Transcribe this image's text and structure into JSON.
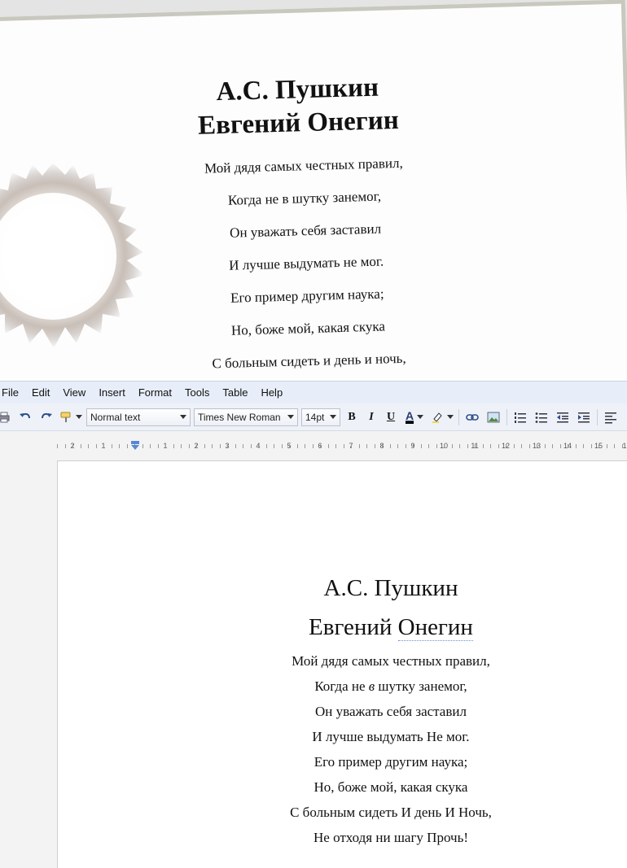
{
  "photo": {
    "title_lines": [
      "А.С. Пушкин",
      "Евгений Онегин"
    ],
    "lines": [
      "Мой дядя самых честных правил,",
      "Когда не в шутку занемог,",
      "Он уважать себя заставил",
      "И лучше выдумать не мог.",
      "Его пример другим наука;",
      "Но, боже мой, какая скука",
      "С больным сидеть и день и ночь,"
    ]
  },
  "menu": [
    "File",
    "Edit",
    "View",
    "Insert",
    "Format",
    "Tools",
    "Table",
    "Help"
  ],
  "toolbar": {
    "style_value": "Normal text",
    "font_value": "Times New Roman",
    "size_value": "14pt",
    "bold_label": "B",
    "italic_label": "I",
    "underline_label": "U",
    "text_color_label": "A",
    "icons": [
      "print-icon",
      "undo-icon",
      "redo-icon",
      "paint-format-icon",
      "link-icon",
      "image-icon",
      "numbered-list-icon",
      "bulleted-list-icon",
      "decrease-indent-icon",
      "increase-indent-icon",
      "align-left-icon"
    ]
  },
  "ruler": {
    "labels": [
      "2",
      "1",
      "1",
      "2",
      "3",
      "4",
      "5",
      "6",
      "7",
      "8",
      "9",
      "10",
      "11",
      "12",
      "13",
      "14",
      "15",
      "1"
    ]
  },
  "document": {
    "title_line1": "А.С. Пушкин",
    "title_line2_part1": "Евгений ",
    "title_line2_part2": "Онегин",
    "lines": [
      [
        "Мой дядя самых честных правил,"
      ],
      [
        "Когда не ",
        "в",
        " шутку занемог,"
      ],
      [
        "Он уважать себя заставил"
      ],
      [
        "И лучше выдумать Не мог."
      ],
      [
        "Его пример другим наука;"
      ],
      [
        "Но, боже мой, какая скука"
      ],
      [
        "С больным сидеть И день И Ночь,"
      ],
      [
        "Не отходя ни шагу Прочь!"
      ]
    ]
  },
  "colors": {
    "menubar": "#e7eef9",
    "toolbar": "#eef2f8",
    "text_color_bar": "#000000",
    "highlight": "#f0d84a"
  }
}
